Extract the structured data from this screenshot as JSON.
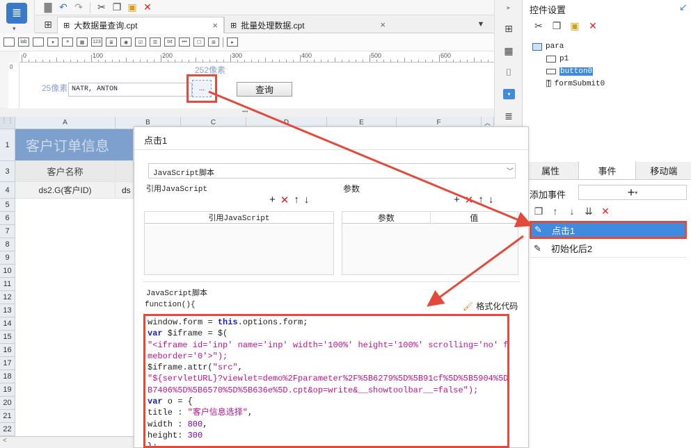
{
  "app": {
    "logo_icon": "report-app-icon",
    "sidebar_toggle": "▾"
  },
  "tabs": [
    {
      "label": "大数据量查询.cpt",
      "close": "×"
    },
    {
      "label": "批量处理数据.cpt",
      "close": "×"
    }
  ],
  "ruler": {
    "marks": [
      "0",
      "100",
      "200",
      "300",
      "400",
      "500",
      "600"
    ],
    "vmark": "0"
  },
  "canvas": {
    "width_label": "252像素",
    "height_label": "25像素",
    "field_value": "NATR, ANTON",
    "ellipsis": "...",
    "query_button": "查询",
    "more": "•••"
  },
  "sheet": {
    "columns": [
      "A",
      "B",
      "C",
      "D",
      "E",
      "F"
    ],
    "rows": [
      "1",
      "3",
      "4",
      "5",
      "6",
      "7",
      "8",
      "9",
      "10",
      "11",
      "12",
      "13",
      "14",
      "15",
      "16",
      "17",
      "18",
      "19",
      "20",
      "21",
      "22"
    ],
    "title_cell": "客户订单信息",
    "header_cell": "客户名称",
    "formula_cell": "ds2.G(客户ID)",
    "formula_cell_b": "ds"
  },
  "dialog": {
    "title": "点击1",
    "type_select": "JavaScript脚本",
    "ref_js_label": "引用JavaScript",
    "ref_js_col": "引用JavaScript",
    "params_label": "参数",
    "params_cols": [
      "参数",
      "值"
    ],
    "script_label": "JavaScript脚本",
    "func_header": "function(){",
    "format_code": "格式化代码",
    "code_lines": [
      "window.form = this.options.form;",
      "var $iframe = $(",
      "\"<iframe id='inp' name='inp' width='100%' height='100%' scrolling='no' fra",
      "meborder='0'>\");",
      "$iframe.attr(\"src\",",
      "\"${servletURL}?viewlet=demo%2Fparameter%2F%5B6279%5D%5B91cf%5D%5B5904%5D%5",
      "B7406%5D%5B6570%5D%5B636e%5D.cpt&op=write&__showtoolbar__=false\");",
      "var o = {",
      "title : \"客户信息选择\",",
      "width : 800,",
      "height: 300",
      "};"
    ]
  },
  "right_panel": {
    "title": "控件设置",
    "tree": {
      "root": "para",
      "children": [
        "p1",
        "button0",
        "formSubmit0"
      ]
    },
    "tabs": [
      "属性",
      "事件",
      "移动端"
    ],
    "add_event_label": "添加事件",
    "events": [
      "点击1",
      "初始化后2"
    ]
  },
  "colors": {
    "accent": "#3e8be0",
    "highlight": "#e24a3b",
    "title_cell": "#7da0cc"
  }
}
